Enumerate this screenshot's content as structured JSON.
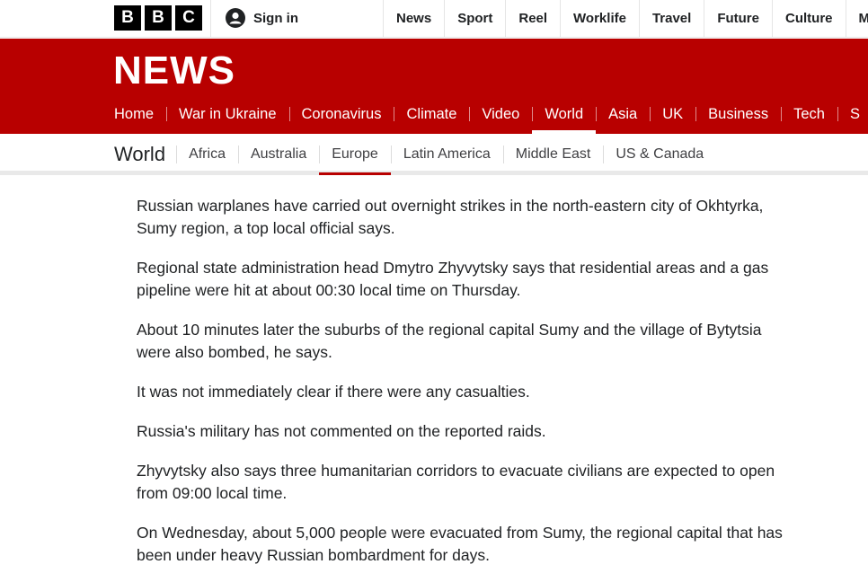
{
  "brand": {
    "letters": [
      "B",
      "B",
      "C"
    ],
    "news_wordmark": "NEWS"
  },
  "topbar": {
    "signin_label": "Sign in",
    "signin_icon": "user-account-icon",
    "links": [
      "News",
      "Sport",
      "Reel",
      "Worklife",
      "Travel",
      "Future",
      "Culture",
      "M"
    ]
  },
  "main_nav": {
    "items": [
      "Home",
      "War in Ukraine",
      "Coronavirus",
      "Climate",
      "Video",
      "World",
      "Asia",
      "UK",
      "Business",
      "Tech",
      "S"
    ],
    "active": "World"
  },
  "section_nav": {
    "title": "World",
    "items": [
      "Africa",
      "Australia",
      "Europe",
      "Latin America",
      "Middle East",
      "US & Canada"
    ],
    "active": "Europe"
  },
  "article": {
    "paragraphs": [
      "Russian warplanes have carried out overnight strikes in the north-eastern city of Okhtyrka, Sumy region, a top local official says.",
      "Regional state administration head Dmytro Zhyvytsky says that residential areas and a gas pipeline were hit at about 00:30 local time on Thursday.",
      "About 10 minutes later the suburbs of the regional capital Sumy and the village of Bytytsia were also bombed, he says.",
      "It was not immediately clear if there were any casualties.",
      "Russia's military has not commented on the reported raids.",
      "Zhyvytsky also says three humanitarian corridors to evacuate civilians are expected to open from 09:00 local time.",
      "On Wednesday, about 5,000 people were evacuated from Sumy, the regional capital that has been under heavy Russian bombardment for days."
    ]
  },
  "colors": {
    "brand_red": "#b80000",
    "text": "#202224"
  }
}
